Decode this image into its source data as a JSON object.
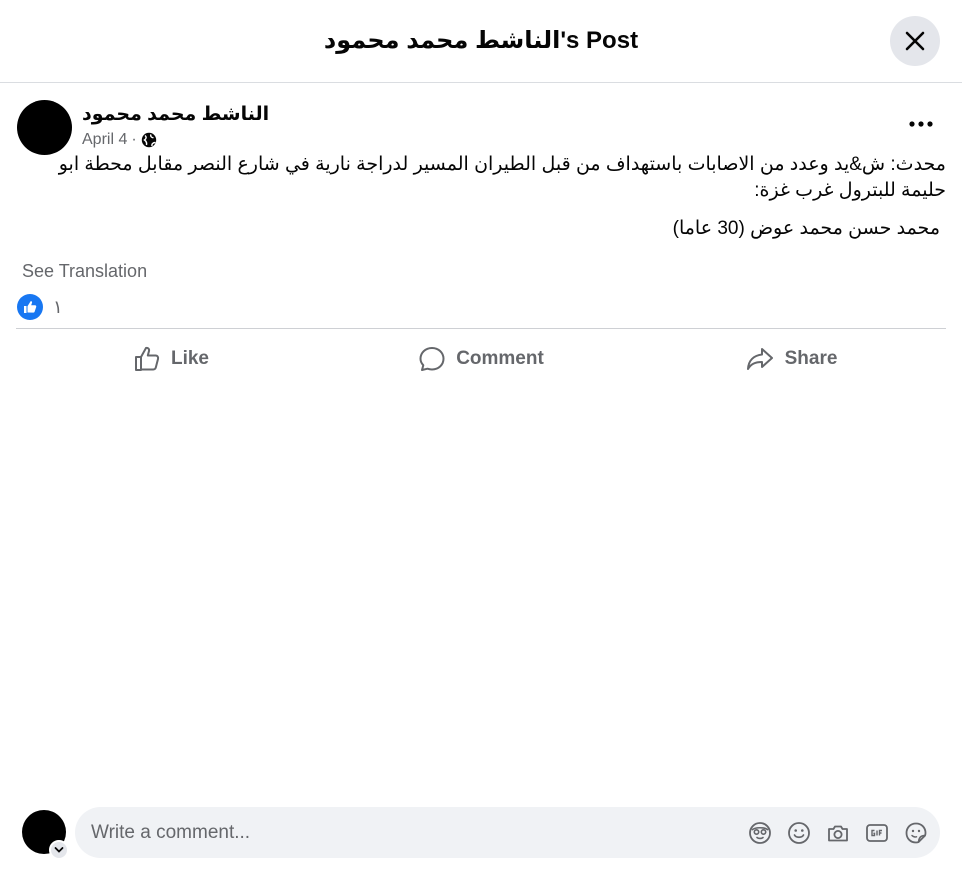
{
  "header": {
    "title": "الناشط محمد محمود's Post"
  },
  "post": {
    "author": "الناشط محمد محمود",
    "date": "April 4",
    "separator": "·",
    "privacy_icon": "globe-icon",
    "text_main": "محدث: ش&يد وعدد من الاصابات باستهداف من قبل الطيران المسير لدراجة نارية في شارع النصر مقابل محطة ابو حليمة للبترول غرب غزة:",
    "text_line": "محمد حسن محمد عوض (30 عاما)",
    "see_translation": "See Translation",
    "reaction_count": "١"
  },
  "actions": {
    "like": "Like",
    "comment": "Comment",
    "share": "Share"
  },
  "composer": {
    "placeholder": "Write a comment...",
    "icons": [
      "avatar-sticker-icon",
      "emoji-icon",
      "camera-icon",
      "gif-icon",
      "sticker-icon"
    ]
  },
  "colors": {
    "accent": "#1877f2",
    "secondary_text": "#65676b",
    "close_bg": "#e4e6eb",
    "composer_bg": "#f0f2f5"
  }
}
